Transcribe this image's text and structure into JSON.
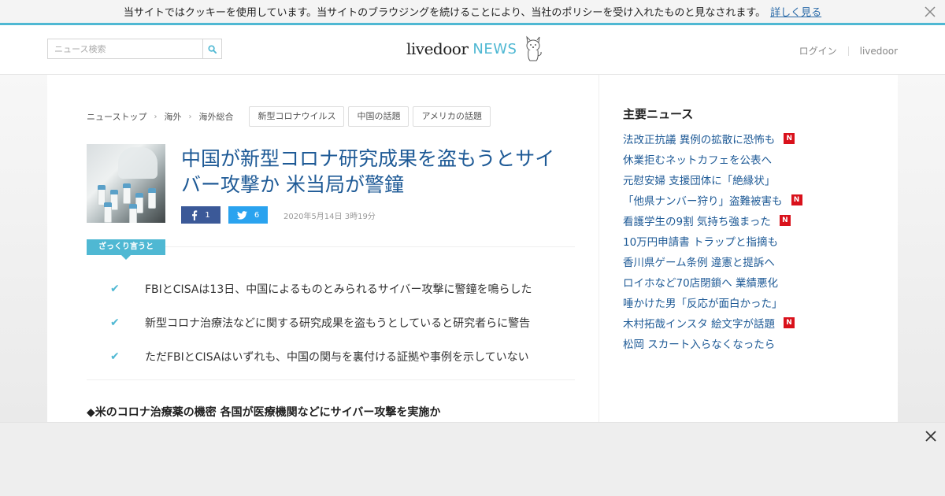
{
  "cookie_bar": {
    "message": "当サイトではクッキーを使用しています。当サイトのブラウジングを続けることにより、当社のポリシーを受け入れたものと見なされます。",
    "more_link": "詳しく見る"
  },
  "header": {
    "search_placeholder": "ニュース検索",
    "logo_brand": "livedoor",
    "logo_news": "NEWS",
    "login": "ログイン",
    "livedoor_link": "livedoor"
  },
  "breadcrumb": {
    "items": [
      "ニューストップ",
      "海外",
      "海外総合"
    ],
    "tags": [
      "新型コロナウイルス",
      "中国の話題",
      "アメリカの話題"
    ]
  },
  "article": {
    "title": "中国が新型コロナ研究成果を盗もうとサイバー攻撃か 米当局が警鐘",
    "facebook_count": "1",
    "twitter_count": "6",
    "date": "2020年5月14日 3時19分",
    "summary_label": "ざっくり言うと",
    "summary": [
      "FBIとCISAは13日、中国によるものとみられるサイバー攻撃に警鐘を鳴らした",
      "新型コロナ治療法などに関する研究成果を盗もうとしていると研究者らに警告",
      "ただFBIとCISAはいずれも、中国の関与を裏付ける証拠や事例を示していない"
    ],
    "sub_heading": "◆米のコロナ治療薬の機密 各国が医療機関などにサイバー攻撃を実施か"
  },
  "sidebar": {
    "title": "主要ニュース",
    "news": [
      {
        "text": "法改正抗議 異例の拡散に恐怖も",
        "new": true
      },
      {
        "text": "休業拒むネットカフェを公表へ",
        "new": false
      },
      {
        "text": "元慰安婦 支援団体に「絶縁状」",
        "new": false
      },
      {
        "text": "「他県ナンバー狩り」盗難被害も",
        "new": true
      },
      {
        "text": "看護学生の9割 気持ち強まった",
        "new": true
      },
      {
        "text": "10万円申請書 トラップと指摘も",
        "new": false
      },
      {
        "text": "香川県ゲーム条例 違憲と提訴へ",
        "new": false
      },
      {
        "text": "ロイホなど70店閉鎖へ 業績悪化",
        "new": false
      },
      {
        "text": "唾かけた男「反応が面白かった」",
        "new": false
      },
      {
        "text": "木村拓哉インスタ 絵文字が話題",
        "new": true
      },
      {
        "text": "松岡 スカート入らなくなったら",
        "new": false
      }
    ],
    "badge_label": "N"
  },
  "colors": {
    "accent": "#4fb8d3",
    "link": "#1e5a96",
    "facebook": "#3b5998",
    "twitter": "#2aa3ef",
    "badge": "#d9111b"
  }
}
